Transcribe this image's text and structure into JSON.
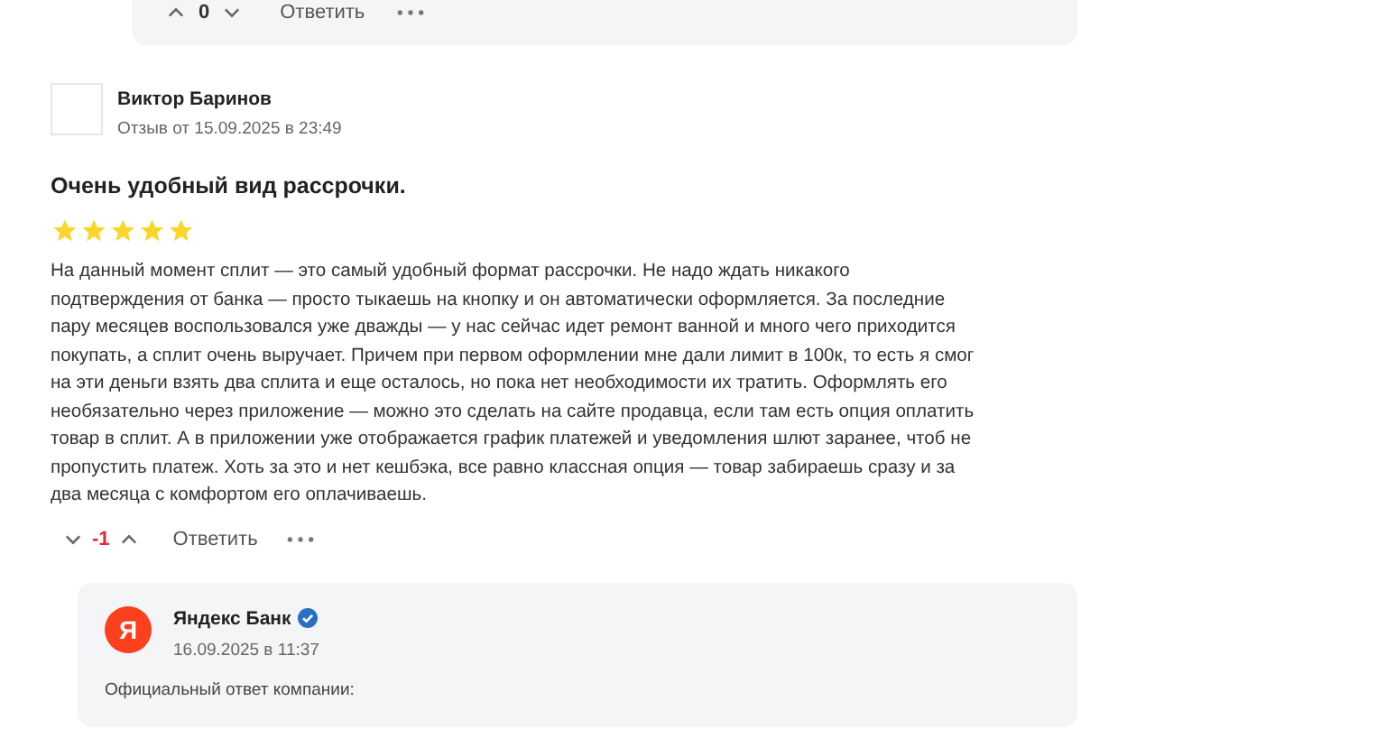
{
  "previous_reply": {
    "score": "0",
    "reply_link": "Ответить"
  },
  "review": {
    "author": "Виктор Баринов",
    "date": "Отзыв от 15.09.2025 в 23:49",
    "title": "Очень удобный вид рассрочки.",
    "stars": 5,
    "text": "На данный момент сплит — это самый удобный формат рассрочки. Не надо ждать никакого подтверждения от банка — просто тыкаешь на кнопку и он автоматически оформляется. За последние пару месяцев воспользовался уже дважды — у нас сейчас идет ремонт ванной и много чего приходится покупать, а сплит очень выручает. Причем при первом оформлении мне дали лимит в 100к, то есть я смог на эти деньги взять два сплита и еще осталось, но пока нет необходимости их тратить. Оформлять его необязательно через приложение — можно это сделать на сайте продавца, если там есть опция оплатить товар в сплит. А в приложении уже отображается график платежей и уведомления шлют заранее, чтоб не пропустить платеж. Хоть за это и нет кешбэка, все равно классная опция — товар забираешь сразу и за два месяца с комфортом его оплачиваешь.",
    "score": "-1",
    "reply_link": "Ответить"
  },
  "company_reply": {
    "logo_letter": "Я",
    "name": "Яндекс Банк",
    "verified": true,
    "date": "16.09.2025 в 11:37",
    "label": "Официальный ответ компании:"
  }
}
